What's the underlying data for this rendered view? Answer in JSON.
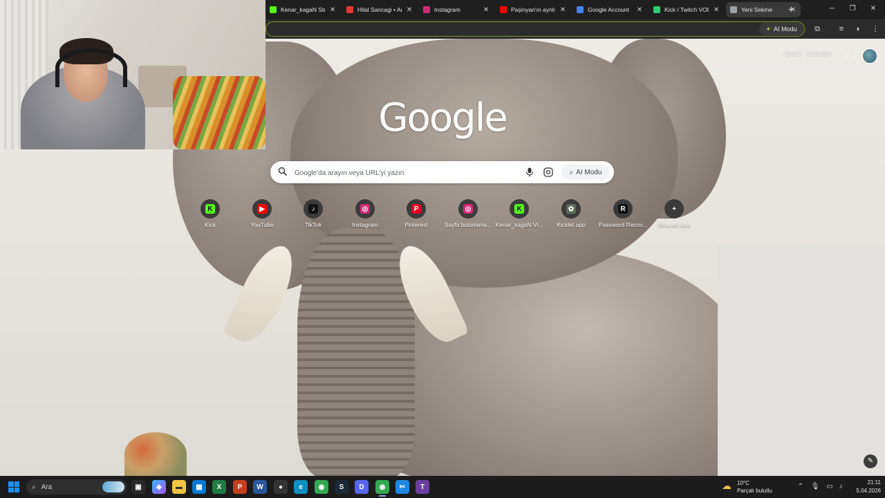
{
  "tabs": [
    {
      "title": "Kenar_kagaN Stre",
      "favicon": "kick-icon",
      "color": "#53fc18"
    },
    {
      "title": "Hilal Sancagi • An",
      "favicon": "record-icon",
      "color": "#e53935"
    },
    {
      "title": "Instagram",
      "favicon": "instagram-icon",
      "color": "#d62976"
    },
    {
      "title": "Paşinyan'ın aynlık",
      "favicon": "youtube-icon",
      "color": "#ff0000"
    },
    {
      "title": "Google Account",
      "favicon": "google-icon",
      "color": "#4285f4"
    },
    {
      "title": "Kick / Twitch VOD",
      "favicon": "d-icon",
      "color": "#2ecc71"
    },
    {
      "title": "Yeni Sekme",
      "favicon": "chrome-icon",
      "color": "#9aa0a6",
      "active": true
    }
  ],
  "toolbar": {
    "ai_mode_label": "AI Modu"
  },
  "header": {
    "gmail": "Gmail",
    "images": "Görseller"
  },
  "logo": "Google",
  "search": {
    "placeholder": "Google'da arayın veya URL'yi yazın",
    "ai_button": "AI Modu"
  },
  "shortcuts": [
    {
      "label": "Kick",
      "icon": "kick-icon",
      "glyph": "K",
      "color": "#53fc18",
      "fg": "#111"
    },
    {
      "label": "YouTube",
      "icon": "youtube-icon",
      "glyph": "▶",
      "color": "#ff0000",
      "fg": "#fff"
    },
    {
      "label": "TikTok",
      "icon": "tiktok-icon",
      "glyph": "♪",
      "color": "#111111",
      "fg": "#fff"
    },
    {
      "label": "Instagram",
      "icon": "instagram-icon",
      "glyph": "◎",
      "color": "#d62976",
      "fg": "#fff"
    },
    {
      "label": "Pinterest",
      "icon": "pinterest-icon",
      "glyph": "P",
      "color": "#e60023",
      "fg": "#fff"
    },
    {
      "label": "Sayfa bulunama...",
      "icon": "instagram-icon",
      "glyph": "◎",
      "color": "#d62976",
      "fg": "#fff"
    },
    {
      "label": "Kenar_kagaN Vi...",
      "icon": "kick-icon",
      "glyph": "K",
      "color": "#53fc18",
      "fg": "#111"
    },
    {
      "label": "Kicklet.app",
      "icon": "kicklet-icon",
      "glyph": "✿",
      "color": "#5d6d5a",
      "fg": "#fff"
    },
    {
      "label": "Password Recov...",
      "icon": "r-icon",
      "glyph": "R",
      "color": "#111111",
      "fg": "#fff"
    },
    {
      "label": "Kısayol ekle",
      "icon": "plus-icon",
      "glyph": "+",
      "color": "#3b3b3b",
      "fg": "#fff"
    }
  ],
  "taskbar": {
    "search_label": "Ara",
    "weather_temp": "10°C",
    "weather_desc": "Parçalı bulutlu",
    "time": "21:11",
    "date": "5.04.2026"
  }
}
